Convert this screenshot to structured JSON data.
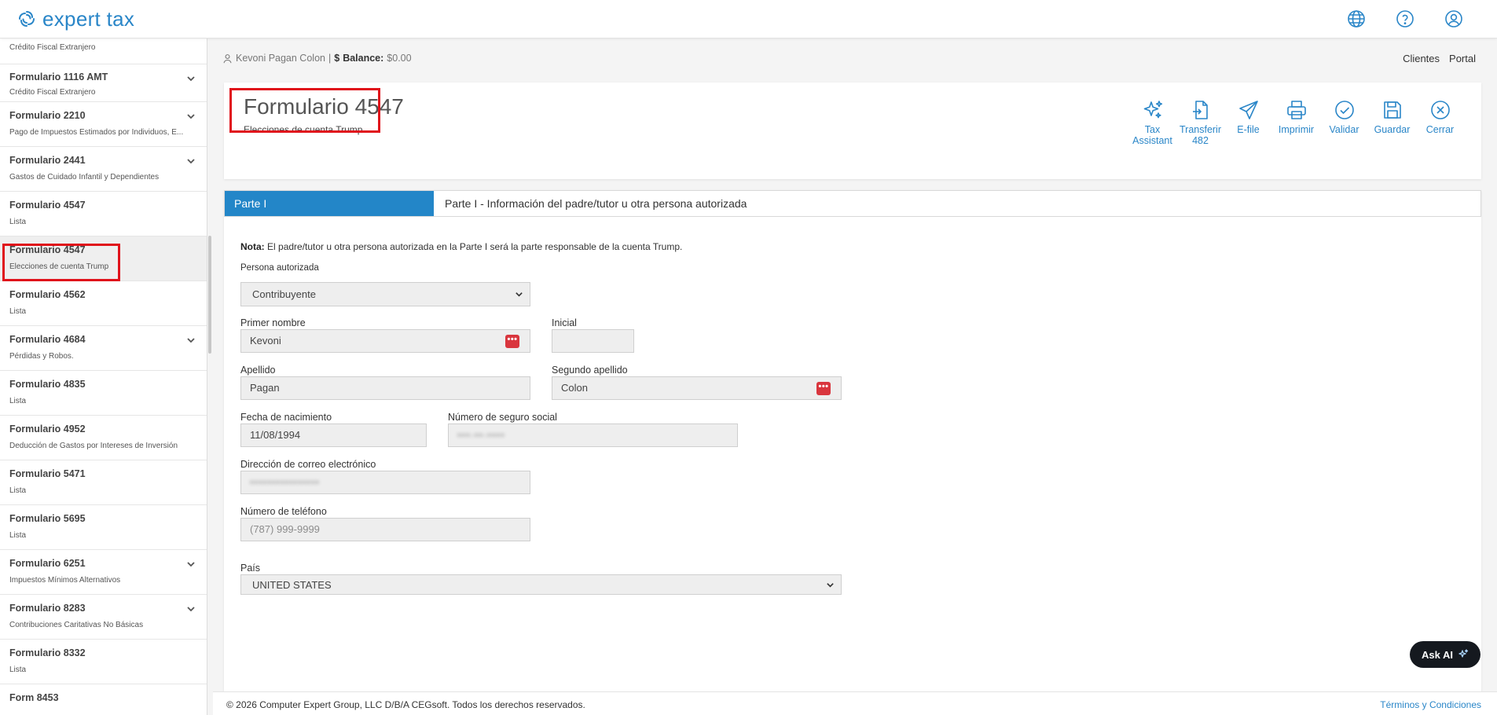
{
  "app": {
    "brand": "expert tax",
    "accent": "#2a86c8"
  },
  "topbar": {
    "icons": [
      "globe-icon",
      "help-circle-icon",
      "user-circle-icon"
    ]
  },
  "sidebar": {
    "items": [
      {
        "title": "",
        "subtitle": "Crédito Fiscal Extranjero",
        "chevron": false
      },
      {
        "title": "Formulario 1116 AMT",
        "subtitle": "Crédito Fiscal Extranjero",
        "chevron": true
      },
      {
        "title": "Formulario 2210",
        "subtitle": "Pago de Impuestos Estimados por Individuos, E...",
        "chevron": true
      },
      {
        "title": "Formulario 2441",
        "subtitle": "Gastos de Cuidado Infantil y Dependientes",
        "chevron": true
      },
      {
        "title": "Formulario 4547",
        "subtitle": "Lista",
        "chevron": false
      },
      {
        "title": "Formulario 4547",
        "subtitle": "Elecciones de cuenta Trump",
        "chevron": false,
        "active": true
      },
      {
        "title": "Formulario 4562",
        "subtitle": "Lista",
        "chevron": false
      },
      {
        "title": "Formulario 4684",
        "subtitle": "Pérdidas y Robos.",
        "chevron": true
      },
      {
        "title": "Formulario 4835",
        "subtitle": "Lista",
        "chevron": false
      },
      {
        "title": "Formulario 4952",
        "subtitle": "Deducción de Gastos por Intereses de Inversión",
        "chevron": false
      },
      {
        "title": "Formulario 5471",
        "subtitle": "Lista",
        "chevron": false
      },
      {
        "title": "Formulario 5695",
        "subtitle": "Lista",
        "chevron": false
      },
      {
        "title": "Formulario 6251",
        "subtitle": "Impuestos Mínimos Alternativos",
        "chevron": true
      },
      {
        "title": "Formulario 8283",
        "subtitle": "Contribuciones Caritativas No Básicas",
        "chevron": true
      },
      {
        "title": "Formulario 8332",
        "subtitle": "Lista",
        "chevron": false
      },
      {
        "title": "Form 8453",
        "subtitle": "",
        "chevron": false
      }
    ]
  },
  "breadcrumb": {
    "client": "Kevoni Pagan Colon",
    "separator": "|",
    "currency": "$",
    "balance_label": "Balance:",
    "balance_value": "$0.00"
  },
  "toplinks": {
    "clients": "Clientes",
    "portal": "Portal"
  },
  "header": {
    "title": "Formulario 4547",
    "subtitle": "Elecciones de cuenta Trump"
  },
  "actions": [
    {
      "line1": "Tax",
      "line2": "Assistant",
      "icon": "sparkles-icon"
    },
    {
      "line1": "Transferir",
      "line2": "482",
      "icon": "file-transfer-icon"
    },
    {
      "line1": "E-file",
      "line2": "",
      "icon": "send-icon"
    },
    {
      "line1": "Imprimir",
      "line2": "",
      "icon": "printer-icon"
    },
    {
      "line1": "Validar",
      "line2": "",
      "icon": "check-circle-icon"
    },
    {
      "line1": "Guardar",
      "line2": "",
      "icon": "save-icon"
    },
    {
      "line1": "Cerrar",
      "line2": "",
      "icon": "close-circle-icon"
    }
  ],
  "tabs": {
    "active": "Parte I",
    "description": "Parte I - Información del padre/tutor u otra persona autorizada"
  },
  "form": {
    "nota_label": "Nota:",
    "nota_text": "El padre/tutor u otra persona autorizada en la Parte I será la parte responsable de la cuenta Trump.",
    "persona_label": "Persona autorizada",
    "persona_value": "Contribuyente",
    "primer_nombre_label": "Primer nombre",
    "primer_nombre_value": "Kevoni",
    "inicial_label": "Inicial",
    "inicial_value": "",
    "apellido_label": "Apellido",
    "apellido_value": "Pagan",
    "segundo_apellido_label": "Segundo apellido",
    "segundo_apellido_value": "Colon",
    "fecha_label": "Fecha de nacimiento",
    "fecha_value": "11/08/1994",
    "ssn_label": "Número de seguro social",
    "ssn_value": "•••-••-••••",
    "email_label": "Dirección de correo electrónico",
    "email_value": "••••••••••••••••",
    "telefono_label": "Número de teléfono",
    "telefono_placeholder": "(787) 999-9999",
    "pais_label": "País",
    "pais_value": "UNITED STATES",
    "dots": "•••"
  },
  "ask_ai": "Ask AI",
  "footer": {
    "copyright": "© 2026 Computer Expert Group, LLC D/B/A CEGsoft. Todos los derechos reservados.",
    "terms": "Términos y Condiciones"
  }
}
